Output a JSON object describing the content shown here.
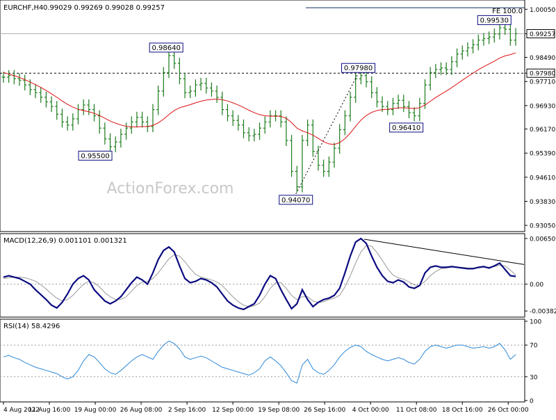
{
  "header": {
    "symbol": "EURCHF,H4",
    "ohlc": "0.99029 0.99269 0.99028 0.99257"
  },
  "watermark": "ActionForex.com",
  "colors": {
    "candle": "#1a7a1a",
    "ma": "#dd1111",
    "macd_main": "#0a0a80",
    "macd_signal": "#999999",
    "rsi": "#2b88d8",
    "label_border": "#0a0a80",
    "grid": "#000000"
  },
  "chart_data": [
    {
      "type": "candlestick",
      "name": "price",
      "title": "EURCHF,H4",
      "ylim": [
        0.9285,
        1.0035
      ],
      "y_ticks": [
        "1.00050",
        "0.99257",
        "0.98490",
        "0.97980",
        "0.97710",
        "0.96930",
        "0.96170",
        "0.95390",
        "0.94610",
        "0.93830",
        "0.93050"
      ],
      "current_price": 0.99257,
      "current_price_label": "0.99257",
      "resistance_level": 0.9798,
      "resistance_label": "0.97980",
      "fe_label": "FE 100.0",
      "fe_level": 1.001,
      "x_ticks": [
        "4 Aug 2022",
        "11 Aug 16:00",
        "19 Aug 00:00",
        "26 Aug 08:00",
        "2 Sep 16:00",
        "12 Sep 00:00",
        "19 Sep 08:00",
        "26 Sep 16:00",
        "4 Oct 00:00",
        "11 Oct 08:00",
        "18 Oct 16:00",
        "26 Oct 00:00"
      ],
      "x_tick_index": [
        0,
        8.6,
        17.2,
        25.8,
        34.4,
        43.0,
        51.6,
        60.2,
        68.8,
        77.4,
        86.0,
        94.6
      ],
      "annotations": [
        {
          "text": "0.98640",
          "index": 30.5,
          "price": 0.9864
        },
        {
          "text": "0.95500",
          "index": 17.2,
          "price": 0.955
        },
        {
          "text": "0.94070",
          "index": 54.8,
          "price": 0.9407
        },
        {
          "text": "0.97980",
          "index": 66.5,
          "price": 0.9798
        },
        {
          "text": "0.96410",
          "index": 75.5,
          "price": 0.9641
        },
        {
          "text": "0.99530",
          "index": 92.0,
          "price": 0.9953
        }
      ],
      "trend_line": {
        "from": [
          54.8,
          0.9407
        ],
        "to": [
          66.5,
          0.9798
        ]
      },
      "close": [
        0.9785,
        0.979,
        0.978,
        0.9775,
        0.976,
        0.9745,
        0.9735,
        0.972,
        0.9705,
        0.969,
        0.9665,
        0.964,
        0.963,
        0.965,
        0.968,
        0.9695,
        0.968,
        0.966,
        0.962,
        0.9585,
        0.956,
        0.9575,
        0.96,
        0.962,
        0.964,
        0.9655,
        0.964,
        0.9625,
        0.968,
        0.974,
        0.98,
        0.9855,
        0.983,
        0.978,
        0.9735,
        0.974,
        0.976,
        0.9765,
        0.975,
        0.974,
        0.972,
        0.968,
        0.966,
        0.9645,
        0.963,
        0.9605,
        0.9595,
        0.96,
        0.962,
        0.964,
        0.966,
        0.966,
        0.964,
        0.958,
        0.948,
        0.943,
        0.958,
        0.963,
        0.9545,
        0.95,
        0.948,
        0.951,
        0.9555,
        0.9615,
        0.966,
        0.972,
        0.978,
        0.979,
        0.977,
        0.9735,
        0.9705,
        0.969,
        0.968,
        0.97,
        0.971,
        0.969,
        0.967,
        0.966,
        0.97,
        0.976,
        0.98,
        0.981,
        0.9815,
        0.981,
        0.9835,
        0.986,
        0.987,
        0.988,
        0.989,
        0.9905,
        0.991,
        0.9915,
        0.9925,
        0.9945,
        0.994,
        0.9905,
        0.9926
      ],
      "ma": [
        0.98,
        0.9795,
        0.979,
        0.9784,
        0.9777,
        0.9769,
        0.9761,
        0.9752,
        0.9742,
        0.9731,
        0.972,
        0.9708,
        0.9697,
        0.9688,
        0.9681,
        0.9677,
        0.9673,
        0.9668,
        0.9661,
        0.9652,
        0.9643,
        0.9636,
        0.963,
        0.9626,
        0.9624,
        0.9624,
        0.9625,
        0.9625,
        0.9629,
        0.9637,
        0.9649,
        0.9664,
        0.9677,
        0.9686,
        0.9691,
        0.9696,
        0.9702,
        0.9707,
        0.9711,
        0.9713,
        0.9714,
        0.9712,
        0.9708,
        0.9702,
        0.9695,
        0.9687,
        0.9678,
        0.967,
        0.9664,
        0.966,
        0.9659,
        0.9659,
        0.9658,
        0.9652,
        0.9638,
        0.962,
        0.9611,
        0.9605,
        0.9597,
        0.9587,
        0.9576,
        0.9569,
        0.9567,
        0.9573,
        0.9586,
        0.9604,
        0.9626,
        0.9646,
        0.9661,
        0.9671,
        0.9677,
        0.968,
        0.9681,
        0.9683,
        0.9686,
        0.9686,
        0.9685,
        0.9683,
        0.9686,
        0.9695,
        0.9707,
        0.9719,
        0.973,
        0.974,
        0.9751,
        0.9763,
        0.9775,
        0.9787,
        0.9798,
        0.9809,
        0.9819,
        0.9828,
        0.9837,
        0.9847,
        0.9854,
        0.9858,
        0.9864
      ]
    },
    {
      "type": "line",
      "name": "MACD",
      "title": "MACD(12,26,9) 0.001101 0.001321",
      "ylim": [
        -0.0045,
        0.007
      ],
      "y_ticks": [
        "0.006509",
        "0.00",
        "-0.003828"
      ],
      "y_tick_values": [
        0.006509,
        0.0,
        -0.003828
      ],
      "zero_label": "0.00",
      "main": [
        0.001,
        0.0012,
        0.001,
        0.0008,
        0.0004,
        0.0,
        -0.0008,
        -0.0015,
        -0.0022,
        -0.003,
        -0.0034,
        -0.0026,
        -0.0014,
        0.0,
        0.0008,
        0.0012,
        0.0006,
        -0.0008,
        -0.0016,
        -0.0024,
        -0.0028,
        -0.0024,
        -0.0018,
        -0.0008,
        0.0002,
        0.001,
        0.0006,
        0.0,
        0.0016,
        0.0035,
        0.0048,
        0.0053,
        0.0046,
        0.0026,
        0.0008,
        0.0002,
        0.0004,
        0.0008,
        0.0006,
        0.0002,
        -0.0004,
        -0.0014,
        -0.0024,
        -0.003,
        -0.0034,
        -0.0036,
        -0.0032,
        -0.0028,
        -0.0016,
        0.0,
        0.0012,
        0.0008,
        -0.0008,
        -0.0022,
        -0.0035,
        -0.0028,
        -0.0008,
        -0.0022,
        -0.0032,
        -0.0026,
        -0.0022,
        -0.002,
        -0.0016,
        -0.0006,
        0.0016,
        0.004,
        0.006,
        0.0065,
        0.0058,
        0.004,
        0.0024,
        0.0012,
        0.0004,
        0.0002,
        0.0006,
        0.0003,
        -0.0004,
        -0.0006,
        -0.0002,
        0.0016,
        0.0024,
        0.0026,
        0.0024,
        0.0024,
        0.0025,
        0.0024,
        0.0023,
        0.0022,
        0.0022,
        0.0024,
        0.0025,
        0.0023,
        0.0026,
        0.003,
        0.0021,
        0.0012,
        0.0011
      ],
      "signal": [
        0.0008,
        0.0009,
        0.001,
        0.001,
        0.0009,
        0.0007,
        0.0004,
        -0.0001,
        -0.0007,
        -0.0014,
        -0.002,
        -0.0024,
        -0.0022,
        -0.0016,
        -0.0008,
        0.0,
        0.0004,
        0.0002,
        -0.0004,
        -0.0012,
        -0.0018,
        -0.0022,
        -0.0022,
        -0.0018,
        -0.001,
        -0.0002,
        0.0003,
        0.0004,
        0.0008,
        0.0016,
        0.0026,
        0.0036,
        0.0042,
        0.004,
        0.0032,
        0.0022,
        0.0014,
        0.001,
        0.0008,
        0.0006,
        0.0003,
        -0.0002,
        -0.001,
        -0.0018,
        -0.0025,
        -0.003,
        -0.0032,
        -0.0031,
        -0.0027,
        -0.0018,
        -0.0006,
        0.0002,
        0.0002,
        -0.0006,
        -0.0016,
        -0.0022,
        -0.0018,
        -0.0018,
        -0.0024,
        -0.0026,
        -0.0025,
        -0.0022,
        -0.002,
        -0.0016,
        -0.0004,
        0.0012,
        0.003,
        0.0046,
        0.0055,
        0.0054,
        0.0045,
        0.0034,
        0.0022,
        0.0013,
        0.0009,
        0.0007,
        0.0003,
        -0.0001,
        -0.0002,
        0.0004,
        0.0012,
        0.0018,
        0.0022,
        0.0023,
        0.0024,
        0.0024,
        0.0024,
        0.0023,
        0.0023,
        0.0023,
        0.0024,
        0.0024,
        0.0025,
        0.0027,
        0.0026,
        0.002,
        0.0013
      ],
      "trend_line": {
        "from": [
          67.6,
          0.0064
        ],
        "to": [
          99,
          0.0028
        ]
      }
    },
    {
      "type": "line",
      "name": "RSI",
      "title": "RSI(14) 58.4296",
      "ylim": [
        0,
        100
      ],
      "y_ticks": [
        "100",
        "70",
        "30",
        "0"
      ],
      "y_tick_values": [
        100,
        70,
        30,
        0
      ],
      "levels": [
        70,
        30
      ],
      "values": [
        55,
        57,
        54,
        52,
        48,
        45,
        42,
        40,
        38,
        36,
        34,
        30,
        27,
        30,
        38,
        50,
        58,
        55,
        48,
        40,
        35,
        33,
        38,
        44,
        50,
        55,
        58,
        55,
        52,
        62,
        70,
        75,
        72,
        65,
        55,
        52,
        54,
        56,
        54,
        50,
        46,
        42,
        40,
        38,
        36,
        34,
        32,
        35,
        40,
        50,
        55,
        50,
        44,
        35,
        25,
        22,
        45,
        52,
        40,
        35,
        33,
        38,
        45,
        55,
        62,
        67,
        70,
        68,
        62,
        58,
        55,
        52,
        50,
        52,
        54,
        52,
        48,
        46,
        52,
        62,
        68,
        70,
        68,
        66,
        68,
        70,
        70,
        68,
        66,
        67,
        68,
        66,
        68,
        72,
        64,
        52,
        58
      ]
    }
  ]
}
